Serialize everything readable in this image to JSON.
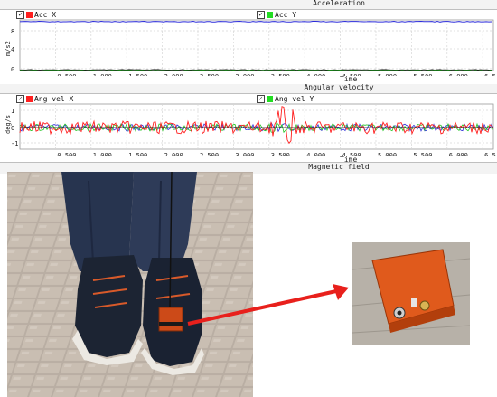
{
  "acceleration": {
    "title": "Acceleration",
    "legend": [
      {
        "label": "Acc X",
        "color": "#ff2020"
      },
      {
        "label": "Acc Y",
        "color": "#22dd22"
      }
    ],
    "ylabel": "m/s2",
    "xtitle": "Time",
    "y_ticks": [
      "8",
      "4",
      "0"
    ],
    "x_ticks": [
      "0.500",
      "1.000",
      "1.500",
      "2.000",
      "2.500",
      "3.000",
      "3.500",
      "4.000",
      "4.500",
      "5.000",
      "5.500",
      "6.000",
      "6.5"
    ]
  },
  "angular_velocity": {
    "title": "Angular velocity",
    "legend": [
      {
        "label": "Ang vel X",
        "color": "#ff2020"
      },
      {
        "label": "Ang vel Y",
        "color": "#22dd22"
      }
    ],
    "ylabel": "deg/s",
    "xtitle": "Time",
    "y_ticks": [
      "1",
      "0",
      "-1"
    ],
    "x_ticks": [
      "0.500",
      "1.000",
      "1.500",
      "2.000",
      "2.500",
      "3.000",
      "3.500",
      "4.000",
      "4.500",
      "5.000",
      "5.500",
      "6.000",
      "6.5"
    ]
  },
  "magnetic": {
    "title": "Magnetic field"
  },
  "colors": {
    "blue": "#2b2bd9",
    "red": "#ff1f1f",
    "green": "#1fc41f",
    "black": "#111111",
    "arrow": "#e8201c"
  }
}
